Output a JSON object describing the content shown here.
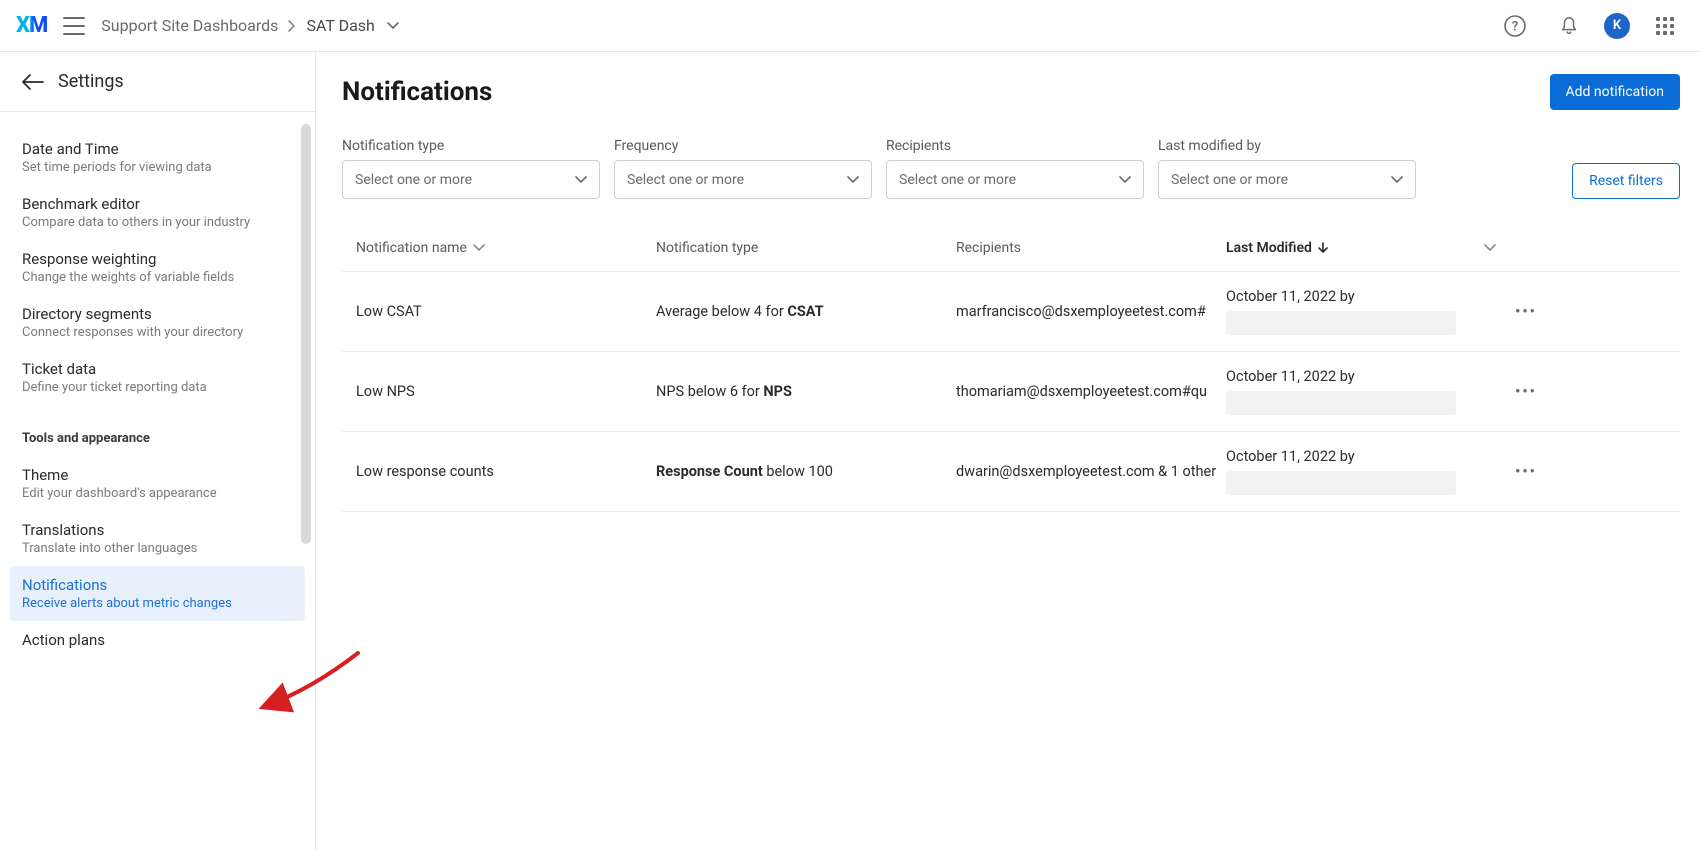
{
  "topbar": {
    "logo_text": "XM",
    "breadcrumb_parent": "Support Site Dashboards",
    "breadcrumb_current": "SAT Dash",
    "avatar_initial": "K"
  },
  "sidebar": {
    "settings_label": "Settings",
    "groups": {
      "data": [
        {
          "title": "Date and Time",
          "sub": "Set time periods for viewing data"
        },
        {
          "title": "Benchmark editor",
          "sub": "Compare data to others in your industry"
        },
        {
          "title": "Response weighting",
          "sub": "Change the weights of variable fields"
        },
        {
          "title": "Directory segments",
          "sub": "Connect responses with your directory"
        },
        {
          "title": "Ticket data",
          "sub": "Define your ticket reporting data"
        }
      ],
      "tools_label": "Tools and appearance",
      "tools": [
        {
          "title": "Theme",
          "sub": "Edit your dashboard's appearance"
        },
        {
          "title": "Translations",
          "sub": "Translate into other languages"
        },
        {
          "title": "Notifications",
          "sub": "Receive alerts about metric changes"
        },
        {
          "title": "Action plans",
          "sub": ""
        }
      ]
    }
  },
  "page": {
    "title": "Notifications",
    "add_button": "Add notification",
    "reset_button": "Reset filters",
    "filters": [
      {
        "label": "Notification type",
        "placeholder": "Select one or more"
      },
      {
        "label": "Frequency",
        "placeholder": "Select one or more"
      },
      {
        "label": "Recipients",
        "placeholder": "Select one or more"
      },
      {
        "label": "Last modified by",
        "placeholder": "Select one or more"
      }
    ],
    "columns": {
      "name": "Notification name",
      "type": "Notification type",
      "recipients": "Recipients",
      "modified": "Last Modified"
    },
    "rows": [
      {
        "name": "Low CSAT",
        "type_prefix": "Average below 4 for ",
        "type_bold": "CSAT",
        "type_suffix": "",
        "recipients": "marfrancisco@dsxemployeetest.com#",
        "modified": "October 11, 2022 by"
      },
      {
        "name": "Low NPS",
        "type_prefix": "NPS below 6 for ",
        "type_bold": "NPS",
        "type_suffix": "",
        "recipients": "thomariam@dsxemployeetest.com#qu",
        "modified": "October 11, 2022 by"
      },
      {
        "name": "Low response counts",
        "type_prefix": "",
        "type_bold": "Response Count",
        "type_suffix": " below 100",
        "recipients": "dwarin@dsxemployeetest.com & 1 other",
        "modified": "October 11, 2022 by"
      }
    ]
  }
}
